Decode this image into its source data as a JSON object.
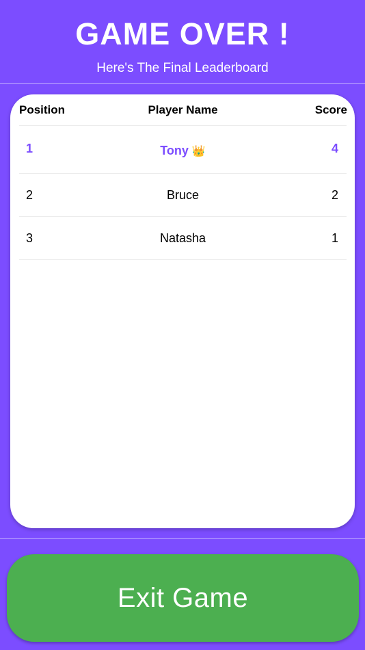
{
  "header": {
    "title": "GAME OVER !",
    "subtitle": "Here's The Final Leaderboard"
  },
  "leaderboard": {
    "columns": {
      "position": "Position",
      "player_name": "Player Name",
      "score": "Score"
    },
    "rows": [
      {
        "position": "1",
        "name": "Tony",
        "badge": "👑",
        "badge_icon": "crown-icon",
        "score": "4"
      },
      {
        "position": "2",
        "name": "Bruce",
        "score": "2"
      },
      {
        "position": "3",
        "name": "Natasha",
        "score": "1"
      }
    ]
  },
  "actions": {
    "exit_label": "Exit Game"
  },
  "colors": {
    "background": "#7c4dff",
    "winner_text": "#7c4dff",
    "exit_button": "#4caf50",
    "card": "#ffffff"
  }
}
